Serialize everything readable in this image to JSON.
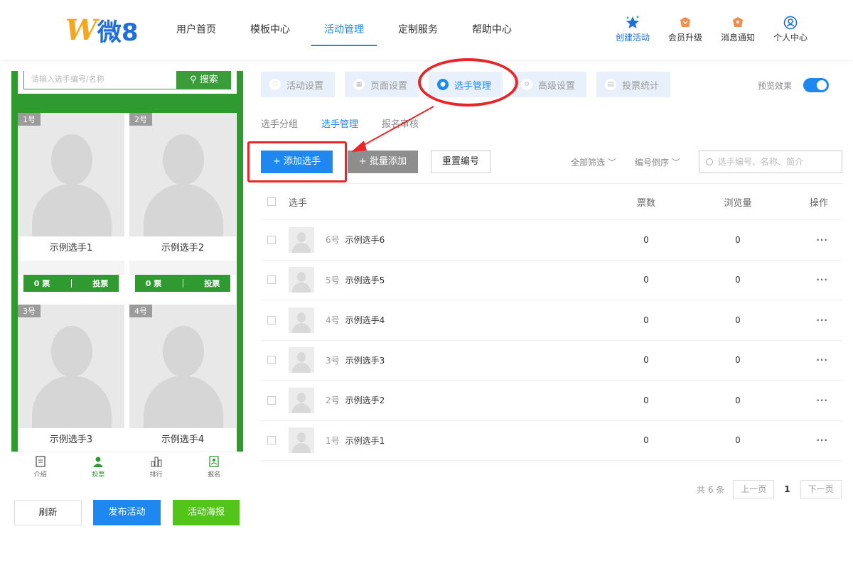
{
  "logo": {
    "letter": "W",
    "text": "微8"
  },
  "nav": [
    {
      "label": "用户首页",
      "active": false
    },
    {
      "label": "模板中心",
      "active": false
    },
    {
      "label": "活动管理",
      "active": true
    },
    {
      "label": "定制服务",
      "active": false
    },
    {
      "label": "帮助中心",
      "active": false
    }
  ],
  "actions": {
    "create": "创建活动",
    "upgrade": "会员升级",
    "notify": "消息通知",
    "profile": "个人中心"
  },
  "preview_phone": {
    "search_placeholder": "请输入选手编号/名称",
    "search_button": "搜索",
    "cards": [
      {
        "num": "1号",
        "name": "示例选手1",
        "votes": "0 票",
        "vote_btn": "投票"
      },
      {
        "num": "2号",
        "name": "示例选手2",
        "votes": "0 票",
        "vote_btn": "投票"
      },
      {
        "num": "3号",
        "name": "示例选手3"
      },
      {
        "num": "4号",
        "name": "示例选手4"
      }
    ],
    "tabbar": [
      {
        "label": "介绍",
        "icon": "doc-icon"
      },
      {
        "label": "投票",
        "icon": "person-icon"
      },
      {
        "label": "排行",
        "icon": "bar-chart-icon"
      },
      {
        "label": "报名",
        "icon": "register-icon"
      }
    ]
  },
  "bottom_buttons": {
    "refresh": "刷新",
    "publish": "发布活动",
    "poster": "活动海报"
  },
  "top_tabs": [
    {
      "label": "活动设置",
      "active": false
    },
    {
      "label": "页面设置",
      "active": false
    },
    {
      "label": "选手管理",
      "active": true
    },
    {
      "label": "高级设置",
      "active": false
    },
    {
      "label": "投票统计",
      "active": false
    }
  ],
  "preview_toggle": {
    "label": "预览效果",
    "on": true
  },
  "sub_tabs": [
    {
      "label": "选手分组",
      "active": false
    },
    {
      "label": "选手管理",
      "active": true
    },
    {
      "label": "报名审核",
      "active": false
    }
  ],
  "toolbar": {
    "add": "+ 添加选手",
    "batch": "+ 批量添加",
    "reset": "重置编号",
    "filter": "全部筛选 ﹀",
    "sort": "编号倒序 ﹀",
    "search_placeholder": "选手编号、名称、简介"
  },
  "table": {
    "headers": {
      "player": "选手",
      "votes": "票数",
      "views": "浏览量",
      "ops": "操作"
    },
    "rows": [
      {
        "num": "6号",
        "name": "示例选手6",
        "votes": "0",
        "views": "0",
        "ops": "···"
      },
      {
        "num": "5号",
        "name": "示例选手5",
        "votes": "0",
        "views": "0",
        "ops": "···"
      },
      {
        "num": "4号",
        "name": "示例选手4",
        "votes": "0",
        "views": "0",
        "ops": "···"
      },
      {
        "num": "3号",
        "name": "示例选手3",
        "votes": "0",
        "views": "0",
        "ops": "···"
      },
      {
        "num": "2号",
        "name": "示例选手2",
        "votes": "0",
        "views": "0",
        "ops": "···"
      },
      {
        "num": "1号",
        "name": "示例选手1",
        "votes": "0",
        "views": "0",
        "ops": "···"
      }
    ]
  },
  "pager": {
    "total": "共 6 条",
    "prev": "上一页",
    "current": "1",
    "next": "下一页"
  },
  "colors": {
    "primary": "#1e87f0",
    "green": "#2f9a2f",
    "annotation": "#e8262a"
  }
}
